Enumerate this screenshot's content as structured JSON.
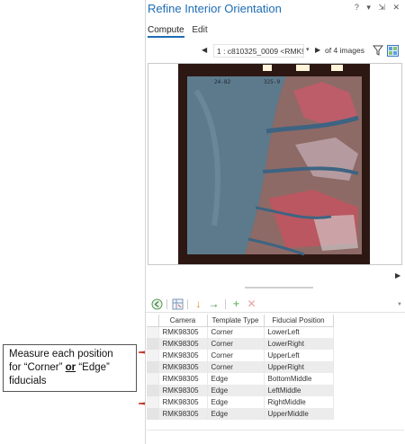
{
  "pane": {
    "title": "Refine Interior Orientation",
    "controls": "? ▾ ⇲ ✕"
  },
  "tabs": [
    {
      "label": "Compute"
    },
    {
      "label": "Edit"
    }
  ],
  "navigator": {
    "current_image": "1 : c810325_0009 <RMK983",
    "count_text": "of 4 images"
  },
  "photo": {
    "label_left": "24-82",
    "label_center": "325-9"
  },
  "table": {
    "columns": [
      "Camera",
      "Template Type",
      "Fiducial Position"
    ],
    "rows": [
      [
        "RMK98305",
        "Corner",
        "LowerLeft"
      ],
      [
        "RMK98305",
        "Corner",
        "LowerRight"
      ],
      [
        "RMK98305",
        "Corner",
        "UpperLeft"
      ],
      [
        "RMK98305",
        "Corner",
        "UpperRight"
      ],
      [
        "RMK98305",
        "Edge",
        "BottomMiddle"
      ],
      [
        "RMK98305",
        "Edge",
        "LeftMiddle"
      ],
      [
        "RMK98305",
        "Edge",
        "RightMiddle"
      ],
      [
        "RMK98305",
        "Edge",
        "UpperMiddle"
      ]
    ]
  },
  "callout": {
    "line1": "Measure each position",
    "line2_pre": "for “Corner” ",
    "line2_bold": "or",
    "line2_post": " “Edge”",
    "line3": "fiducials"
  },
  "colors": {
    "accent": "#1e6db4",
    "brace": "#c0392b"
  }
}
